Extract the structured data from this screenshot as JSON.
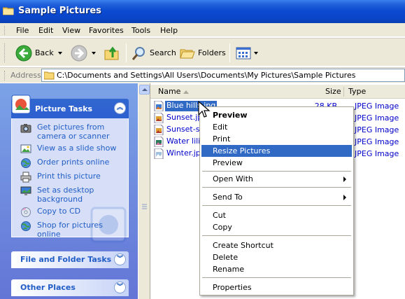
{
  "window": {
    "title": "Sample Pictures",
    "icon": "folder-icon"
  },
  "menubar": {
    "items": [
      "File",
      "Edit",
      "View",
      "Favorites",
      "Tools",
      "Help"
    ]
  },
  "toolbar": {
    "back": "Back",
    "search": "Search",
    "folders": "Folders"
  },
  "address": {
    "label": "Address",
    "path": "C:\\Documents and Settings\\All Users\\Documents\\My Pictures\\Sample Pictures"
  },
  "taskpane": {
    "picture_tasks": {
      "title": "Picture Tasks",
      "items": [
        {
          "label": "Get pictures from camera or scanner",
          "icon": "camera-icon"
        },
        {
          "label": "View as a slide show",
          "icon": "slideshow-icon"
        },
        {
          "label": "Order prints online",
          "icon": "globe-icon"
        },
        {
          "label": "Print this picture",
          "icon": "printer-icon"
        },
        {
          "label": "Set as desktop background",
          "icon": "desktop-icon"
        },
        {
          "label": "Copy to CD",
          "icon": "cd-icon"
        },
        {
          "label": "Shop for pictures online",
          "icon": "globe-icon"
        }
      ]
    },
    "file_folder_tasks": {
      "title": "File and Folder Tasks"
    },
    "other_places": {
      "title": "Other Places"
    }
  },
  "filelist": {
    "columns": {
      "name": "Name",
      "size": "Size",
      "type": "Type"
    },
    "files": [
      {
        "name": "Blue hills.jpg",
        "size": "28 KB",
        "type": "JPEG Image",
        "selected": true
      },
      {
        "name": "Sunset.jpg",
        "size": "",
        "type": "JPEG Image"
      },
      {
        "name": "Sunset-sm",
        "size": "",
        "type": "JPEG Image"
      },
      {
        "name": "Water lilie",
        "size": "",
        "type": "JPEG Image"
      },
      {
        "name": "Winter.jpg",
        "size": "",
        "type": "JPEG Image"
      }
    ]
  },
  "context_menu": {
    "items": [
      {
        "label": "Preview",
        "bold": true
      },
      {
        "label": "Edit"
      },
      {
        "label": "Print"
      },
      {
        "label": "Resize Pictures",
        "highlighted": true
      },
      {
        "label": "Preview"
      },
      {
        "sep": true
      },
      {
        "label": "Open With",
        "submenu": true
      },
      {
        "sep": true
      },
      {
        "label": "Send To",
        "submenu": true
      },
      {
        "sep": true
      },
      {
        "label": "Cut"
      },
      {
        "label": "Copy"
      },
      {
        "sep": true
      },
      {
        "label": "Create Shortcut"
      },
      {
        "label": "Delete"
      },
      {
        "label": "Rename"
      },
      {
        "sep": true
      },
      {
        "label": "Properties"
      }
    ]
  },
  "colors": {
    "title_blue": "#0a49d0",
    "taskpane_blue": "#6375d6",
    "link_blue": "#215dc6",
    "selection": "#316ac5",
    "chrome": "#ece9d8"
  }
}
